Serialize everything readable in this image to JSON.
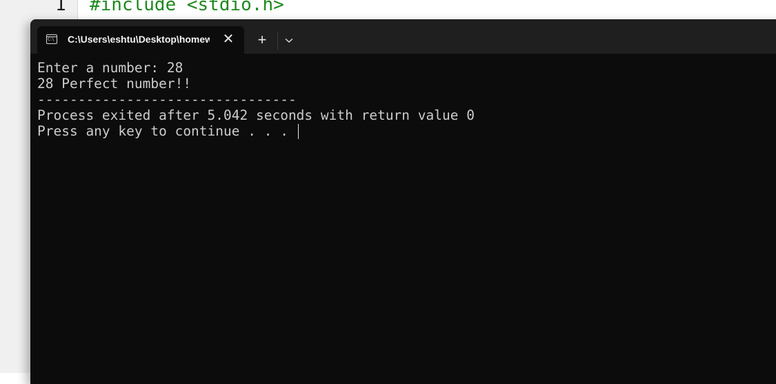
{
  "editor": {
    "line_number": "1",
    "code_line": "#include <stdio.h>"
  },
  "terminal": {
    "tab_title": "C:\\Users\\eshtu\\Desktop\\homework.exe",
    "tab_icon": "console-icon",
    "close_icon": "close-icon",
    "new_tab_label": "+",
    "dropdown_icon": "chevron-down-icon",
    "lines": [
      "Enter a number: 28",
      "28 Perfect number!!",
      "--------------------------------",
      "Process exited after 5.042 seconds with return value 0",
      "Press any key to continue . . . "
    ]
  }
}
